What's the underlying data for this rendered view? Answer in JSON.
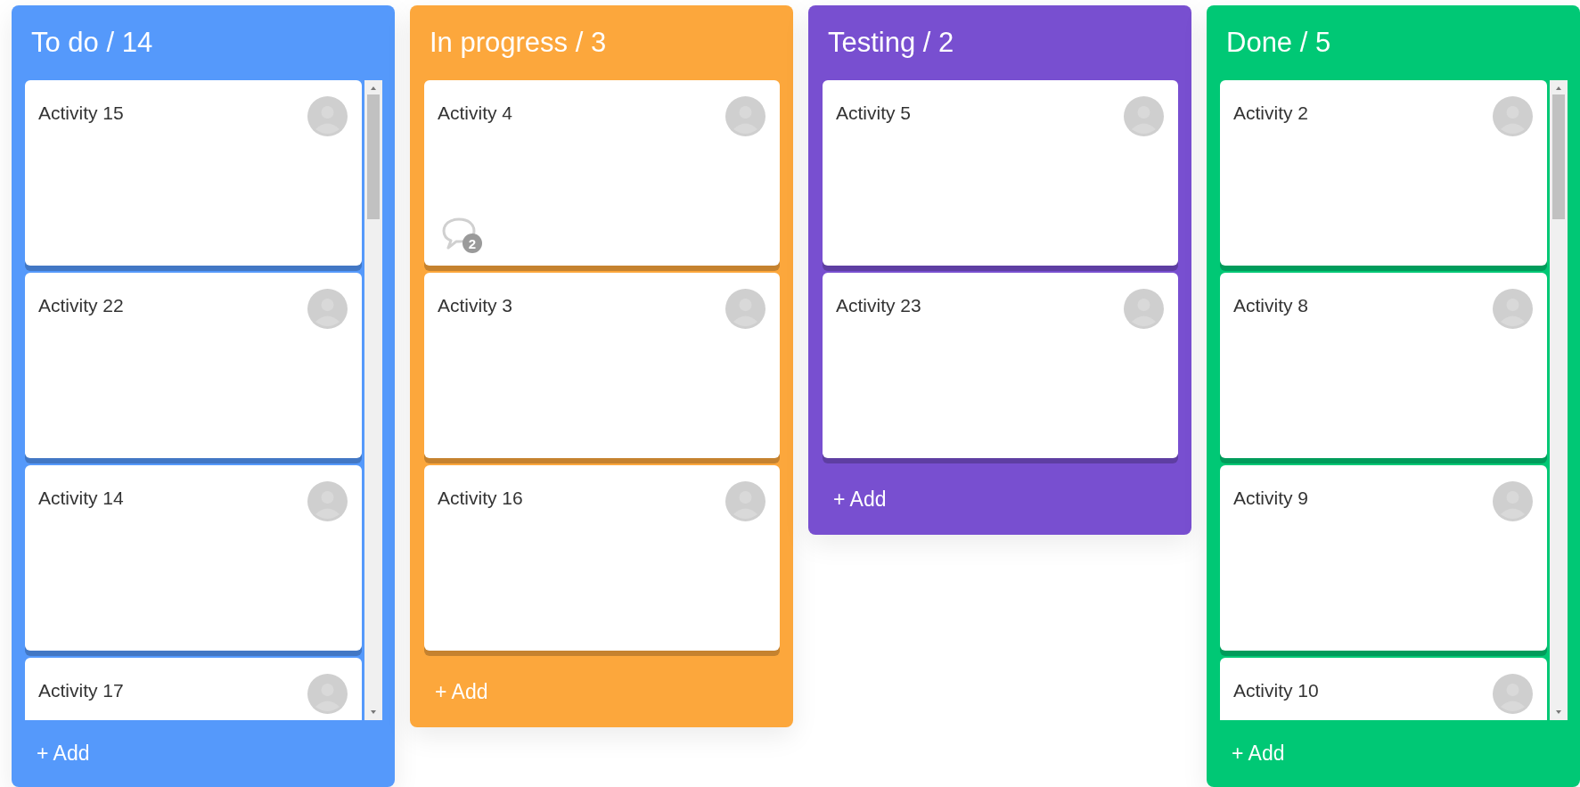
{
  "columns": [
    {
      "title": "To do / 14",
      "color": "#5599fb",
      "scrollable": true,
      "cards": [
        {
          "title": "Activity 15"
        },
        {
          "title": "Activity 22"
        },
        {
          "title": "Activity 14"
        },
        {
          "title": "Activity 17"
        }
      ],
      "add": "+ Add"
    },
    {
      "title": "In progress / 3",
      "color": "#fca73c",
      "scrollable": false,
      "cards": [
        {
          "title": "Activity 4",
          "comments": "2"
        },
        {
          "title": "Activity 3"
        },
        {
          "title": "Activity 16"
        }
      ],
      "add": "+ Add"
    },
    {
      "title": "Testing / 2",
      "color": "#784fd0",
      "scrollable": false,
      "cards": [
        {
          "title": "Activity 5"
        },
        {
          "title": "Activity 23"
        }
      ],
      "add": "+ Add"
    },
    {
      "title": "Done / 5",
      "color": "#00c875",
      "scrollable": true,
      "cards": [
        {
          "title": "Activity 2"
        },
        {
          "title": "Activity 8"
        },
        {
          "title": "Activity 9"
        },
        {
          "title": "Activity 10"
        }
      ],
      "add": "+ Add"
    }
  ]
}
